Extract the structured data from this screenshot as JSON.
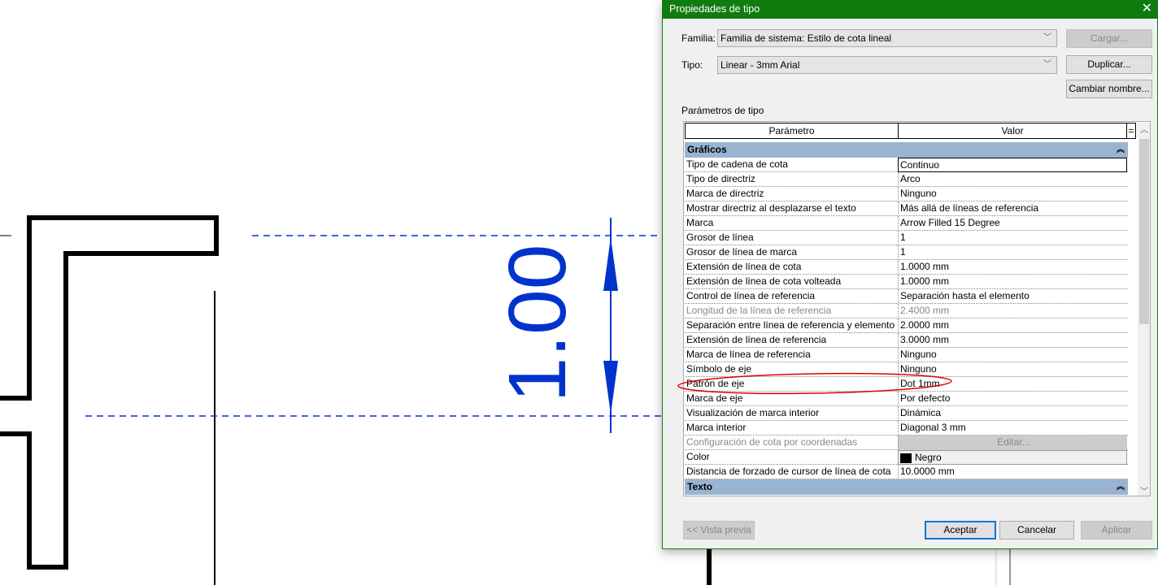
{
  "drawing": {
    "dimension_text": "1.00",
    "line_color": "#0033cc"
  },
  "dialog": {
    "title": "Propiedades de tipo",
    "familia_label": "Familia:",
    "familia_value": "Familia de sistema: Estilo de cota lineal",
    "tipo_label": "Tipo:",
    "tipo_value": "Linear - 3mm Arial",
    "cargar": "Cargar...",
    "duplicar": "Duplicar...",
    "cambiar": "Cambiar nombre...",
    "params_label": "Parámetros de tipo",
    "col_param": "Parámetro",
    "col_valor": "Valor",
    "col_eq": "=",
    "groups": [
      {
        "label": "Gráficos"
      },
      {
        "label": "Texto"
      }
    ],
    "rows": [
      {
        "p": "Tipo de cadena de cota",
        "v": "Continuo"
      },
      {
        "p": "Tipo de directriz",
        "v": "Arco"
      },
      {
        "p": "Marca de directriz",
        "v": "Ninguno"
      },
      {
        "p": "Mostrar directriz al desplazarse el texto",
        "v": "Más allá de líneas de referencia"
      },
      {
        "p": "Marca",
        "v": "Arrow Filled 15 Degree"
      },
      {
        "p": "Grosor de línea",
        "v": "1"
      },
      {
        "p": "Grosor de línea de marca",
        "v": "1"
      },
      {
        "p": "Extensión de línea de cota",
        "v": "1.0000 mm"
      },
      {
        "p": "Extensión de línea de cota volteada",
        "v": "1.0000 mm"
      },
      {
        "p": "Control de línea de referencia",
        "v": "Separación hasta el elemento"
      },
      {
        "p": "Longitud de la línea de referencia",
        "v": "2.4000 mm",
        "disabled": true
      },
      {
        "p": "Separación entre línea de referencia y elemento",
        "v": "2.0000 mm"
      },
      {
        "p": "Extensión de línea de referencia",
        "v": "3.0000 mm"
      },
      {
        "p": "Marca de línea de referencia",
        "v": "Ninguno"
      },
      {
        "p": "Símbolo de eje",
        "v": "Ninguno"
      },
      {
        "p": "Patrón de eje",
        "v": "Dot 1mm"
      },
      {
        "p": "Marca de eje",
        "v": "Por defecto"
      },
      {
        "p": "Visualización de marca interior",
        "v": "Dinámica"
      },
      {
        "p": "Marca interior",
        "v": "Diagonal 3 mm"
      },
      {
        "p": "Configuración de cota por coordenadas",
        "v": "Editar...",
        "disabled": true
      },
      {
        "p": "Color",
        "v": "Negro"
      },
      {
        "p": "Distancia de forzado de cursor de línea de cota",
        "v": "10.0000 mm"
      }
    ],
    "vista_previa": "<< Vista previa",
    "aceptar": "Aceptar",
    "cancelar": "Cancelar",
    "aplicar": "Aplicar",
    "highlight_color": "#e00000"
  }
}
